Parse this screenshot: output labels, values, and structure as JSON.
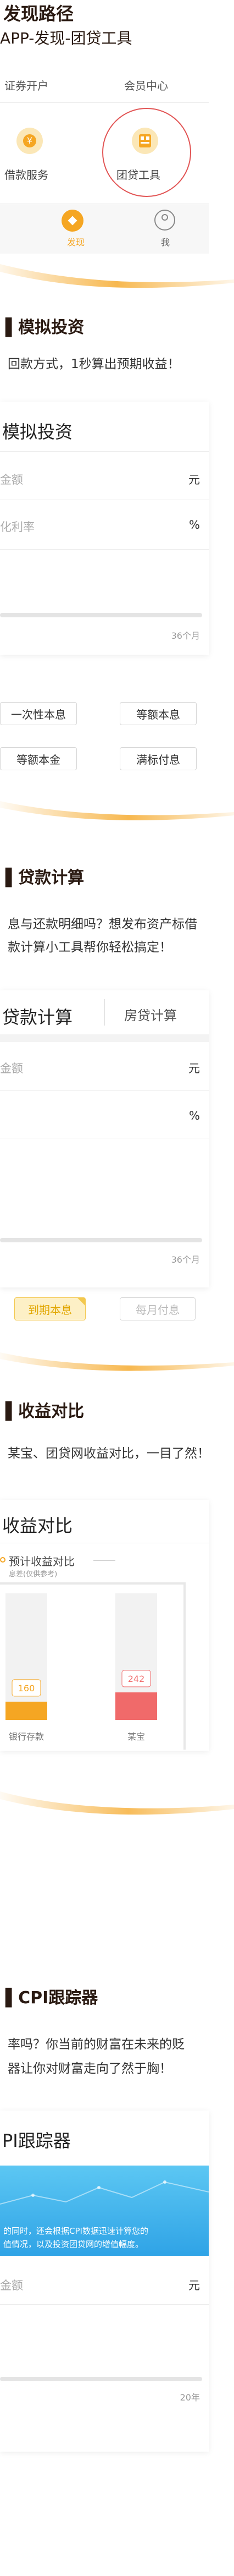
{
  "top": {
    "title": "发现路径",
    "subtitle": "APP-发现-团贷工具",
    "menu_left": "证券开户",
    "menu_right": "会员中心",
    "item_left": "借款服务",
    "item_right": "团贷工具",
    "tab_discover": "发现",
    "tab_me": "我"
  },
  "invest": {
    "title": "模拟投资",
    "desc": "回款方式，1秒算出预期收益！",
    "card_title": "模拟投资",
    "amount_label": "金额",
    "amount_unit": "元",
    "rate_label": "化利率",
    "rate_unit": "%",
    "term_tick": "36个月",
    "opt1": "一次性本息",
    "opt2": "等额本息",
    "opt3": "等额本金",
    "opt4": "满标付息"
  },
  "loan": {
    "title": "贷款计算",
    "desc1": "息与还款明细吗？想发布资产标借",
    "desc2": "款计算小工具帮你轻松搞定！",
    "tab_left": "贷款计算",
    "tab_right": "房贷计算",
    "amount_label": "金额",
    "amount_unit": "元",
    "rate_unit": "%",
    "term_tick": "36个月",
    "opt_active": "到期本息",
    "opt_other": "每月付息"
  },
  "compare": {
    "title": "收益对比",
    "desc": "某宝、团贷网收益对比，一目了然！",
    "card_title": "收益对比",
    "legend": "预计收益对比",
    "legend_sub": "息差(仅供参考)"
  },
  "chart_data": {
    "type": "bar",
    "categories": [
      "银行存款",
      "某宝"
    ],
    "values": [
      160,
      242
    ]
  },
  "cpi": {
    "title": "CPI跟踪器",
    "desc1": "率吗？你当前的财富在未来的贬",
    "desc2": "器让你对财富走向了然于胸！",
    "card_title": "PI跟踪器",
    "banner_text1": "的同时，还会根据CPI数据迅速计算您的",
    "banner_text2": "值情况，以及投资团贷网的增值幅度。",
    "amount_label": "金额",
    "amount_unit": "元",
    "term_tick": "20年"
  },
  "colors": {
    "accent": "#f5a623",
    "bar_bank": "#f5a623",
    "bar_bao": "#f06a6a",
    "banner": "#3ab6ee"
  }
}
